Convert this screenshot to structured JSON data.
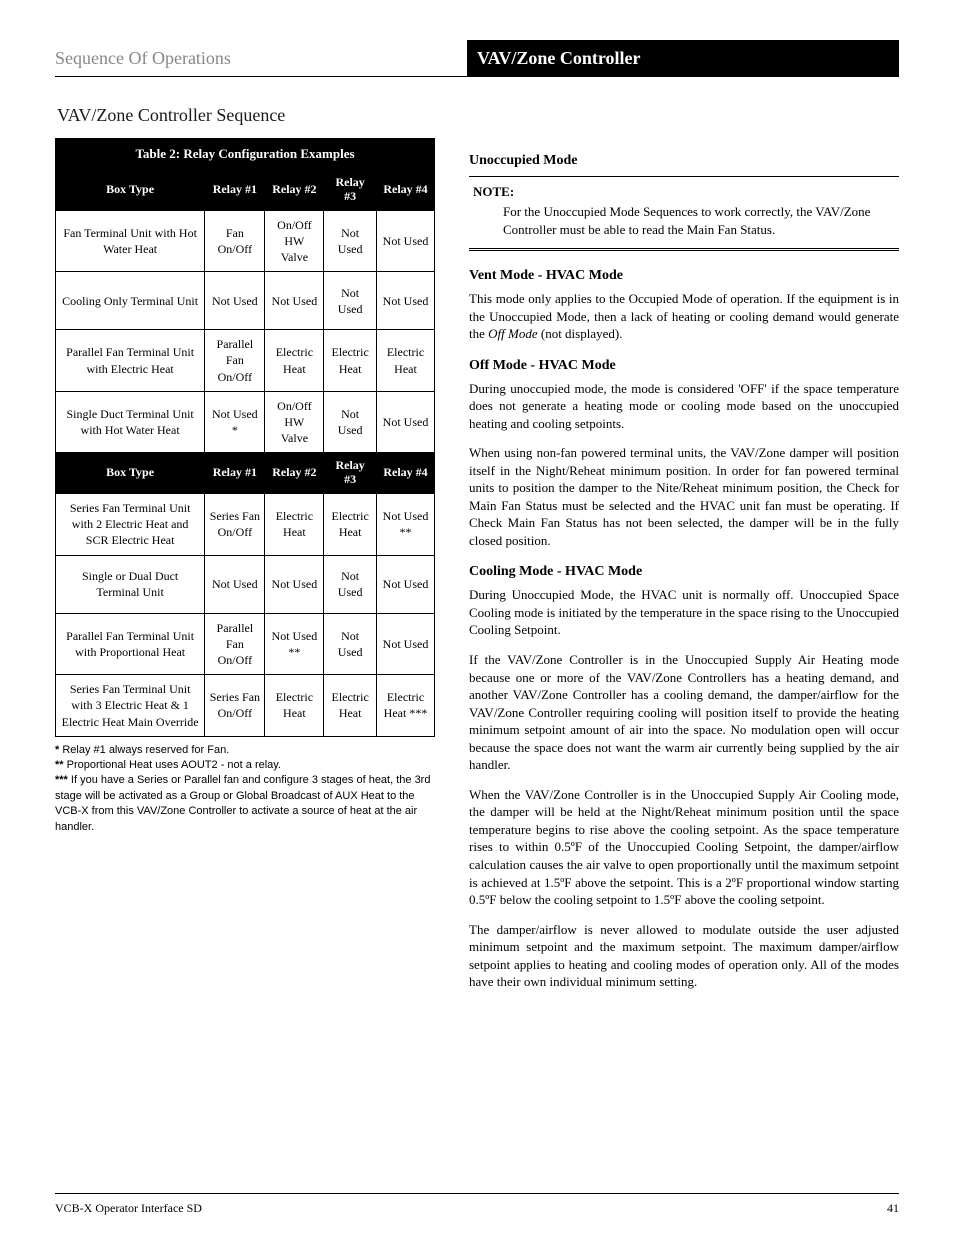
{
  "header": {
    "left": "Sequence Of Operations",
    "right": "VAV/Zone Controller"
  },
  "section_title": "VAV/Zone Controller Sequence",
  "table": {
    "caption": "Table 2: Relay Configuration Examples",
    "col_headers": [
      "Box Type",
      "Relay #1",
      "Relay #2",
      "Relay #3",
      "Relay #4"
    ],
    "groups": [
      {
        "rows": [
          {
            "cells": [
              "Fan Terminal Unit with Hot Water Heat",
              "Fan On/Off",
              "On/Off HW Valve",
              "Not Used",
              "Not Used"
            ]
          },
          {
            "cells": [
              "Cooling Only Terminal Unit",
              "Not Used",
              "Not Used",
              "Not Used",
              "Not Used"
            ]
          },
          {
            "cells": [
              "Parallel Fan Terminal Unit with Electric Heat",
              "Parallel Fan On/Off",
              "Electric Heat",
              "Electric Heat",
              "Electric Heat"
            ]
          },
          {
            "cells": [
              "Single Duct Terminal Unit with Hot Water Heat",
              "Not Used *",
              "On/Off HW Valve",
              "Not Used",
              "Not Used"
            ]
          }
        ]
      },
      {
        "subheader": [
          "Box Type",
          "Relay #1",
          "Relay #2",
          "Relay #3",
          "Relay #4"
        ],
        "rows": [
          {
            "cells": [
              "Series Fan Terminal Unit with 2 Electric Heat and SCR Electric Heat",
              "Series Fan On/Off",
              "Electric Heat",
              "Electric Heat",
              "Not Used **"
            ]
          },
          {
            "cells": [
              "Single or Dual Duct Terminal Unit",
              "Not Used",
              "Not Used",
              "Not Used",
              "Not Used"
            ]
          },
          {
            "cells": [
              "Parallel Fan Terminal Unit with Proportional Heat",
              "Parallel Fan On/Off",
              "Not Used **",
              "Not Used",
              "Not Used"
            ]
          },
          {
            "cells": [
              "Series Fan Terminal Unit with 3 Electric Heat & 1 Electric Heat Main Override",
              "Series Fan On/Off",
              "Electric Heat",
              "Electric Heat",
              "Electric Heat ***"
            ]
          }
        ]
      }
    ],
    "footnotes": [
      {
        "mark": "*",
        "text": "Relay #1 always reserved for Fan."
      },
      {
        "mark": "**",
        "text": "Proportional Heat uses AOUT2 - not a relay."
      },
      {
        "mark": "***",
        "text": "If you have a Series or Parallel fan and configure 3 stages of heat, the 3rd stage will be activated as a Group or Global Broadcast of AUX Heat to the VCB-X from this VAV/Zone Controller to activate a source of heat at the air handler."
      }
    ]
  },
  "right": {
    "h_unoccupied": "Unoccupied Mode",
    "note_label": "NOTE:",
    "note_body": "For the Unoccupied Mode Sequences to work correctly, the VAV/Zone Controller must be able to read the Main Fan Status.",
    "h_vent": "Vent Mode - HVAC Mode",
    "p_vent": "This mode only applies to the Occupied Mode of operation. If the equipment is in the Unoccupied Mode, then a lack of heating or cooling demand would generate the ",
    "p_vent_em": "Off Mode",
    "p_vent_tail": " (not displayed).",
    "h_off": "Off Mode - HVAC Mode",
    "p_off1": "During unoccupied mode, the mode is considered 'OFF' if the space temperature does not generate a heating mode or cooling mode based on the unoccupied heating and cooling setpoints.",
    "p_off2": "When using non-fan powered terminal units, the VAV/Zone damper will position itself in the Night/Reheat minimum position. In order for fan powered terminal units to position the damper to the Nite/Reheat minimum position, the Check for Main Fan Status must be selected and the HVAC unit fan must be operating. If Check Main Fan Status has not been selected, the damper will be in the fully closed position.",
    "h_cool": "Cooling Mode - HVAC Mode",
    "p_cool1": "During Unoccupied Mode, the HVAC unit is normally off. Unoccupied Space Cooling mode is initiated by the temperature in the space rising to the Unoccupied Cooling Setpoint.",
    "p_cool2": "If the VAV/Zone Controller is in the Unoccupied Supply Air Heating mode because one or more of the VAV/Zone Controllers has a heating demand, and another VAV/Zone Controller has a cooling demand, the damper/airflow for the VAV/Zone Controller requiring cooling will position itself to provide the heating minimum setpoint amount of air into the space. No modulation open will occur because the space does not want the warm air currently being supplied by the air handler.",
    "p_cool3": "When the VAV/Zone Controller is in the Unoccupied Supply Air Cooling mode, the damper will be held at the Night/Reheat minimum position until the space temperature begins to rise above the cooling setpoint.  As the space temperature rises to within 0.5ºF of the Unoccupied Cooling Setpoint, the damper/airflow calculation causes the air valve to open proportionally until the maximum setpoint is achieved at 1.5ºF above the setpoint. This is a 2ºF proportional window starting 0.5ºF below the cooling setpoint to 1.5ºF above the cooling setpoint.",
    "p_cool4": "The damper/airflow is never allowed to modulate outside the user adjusted minimum setpoint and the maximum setpoint. The maximum damper/airflow setpoint applies to heating and cooling modes of operation only. All of the modes have their own individual minimum setting."
  },
  "footer": {
    "left": "VCB-X Operator Interface SD",
    "right": "41"
  }
}
